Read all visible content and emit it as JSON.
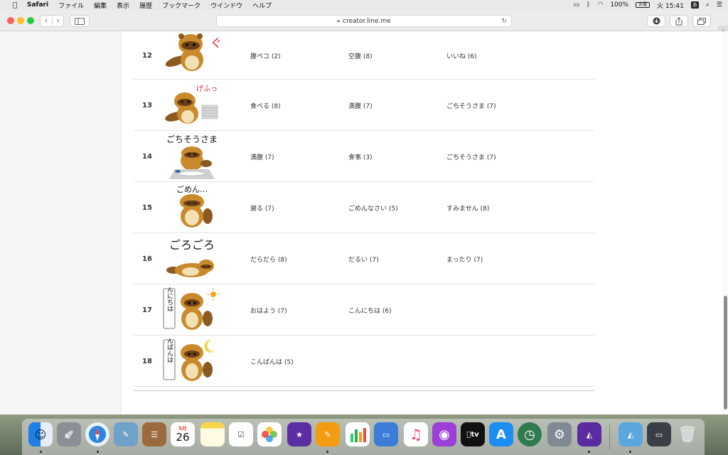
{
  "menubar": {
    "app": "Safari",
    "items": [
      "ファイル",
      "編集",
      "表示",
      "履歴",
      "ブックマーク",
      "ウインドウ",
      "ヘルプ"
    ],
    "battery_percent": "100%",
    "battery_label": "充電",
    "day": "火",
    "time": "15:41",
    "ime": "あ"
  },
  "browser": {
    "url": "creator.line.me",
    "back": "‹",
    "forward": "›",
    "new_tab": "+"
  },
  "stickers": [
    {
      "num": "12",
      "tags": [
        "腹ペコ (2)",
        "空腹 (8)",
        "いいね (6)"
      ],
      "caption": "ぐぅ"
    },
    {
      "num": "13",
      "tags": [
        "食べる (8)",
        "満腹 (7)",
        "ごちそうさま (7)"
      ],
      "caption": "げふっ"
    },
    {
      "num": "14",
      "tags": [
        "満腹 (7)",
        "食事 (3)",
        "ごちそうさま (7)"
      ],
      "caption": "ごちそうさま"
    },
    {
      "num": "15",
      "tags": [
        "謝る (7)",
        "ごめんなさい (5)",
        "すみません (8)"
      ],
      "caption": "ごめん…"
    },
    {
      "num": "16",
      "tags": [
        "だらだら (8)",
        "だるい (7)",
        "まったり (7)"
      ],
      "caption": "ごろごろ"
    },
    {
      "num": "17",
      "tags": [
        "おはよう (7)",
        "こんにちは (6)",
        ""
      ],
      "caption": "こんにちは"
    },
    {
      "num": "18",
      "tags": [
        "こんばんは (5)",
        "",
        ""
      ],
      "caption": "こんばんは"
    }
  ],
  "dock": {
    "calendar_month": "5月",
    "calendar_day": "26",
    "tv_label": "tv"
  }
}
